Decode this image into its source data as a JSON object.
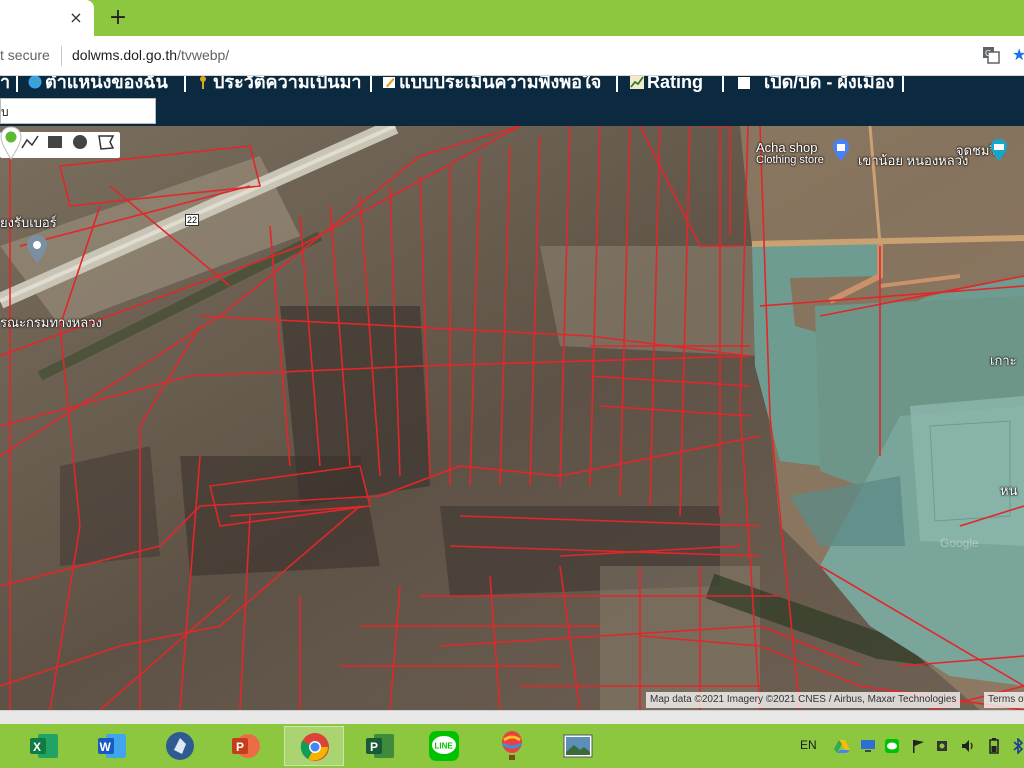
{
  "browser": {
    "tab_close": "×",
    "new_tab": "+",
    "secure_label": "t secure",
    "url_host": "dolwms.dol.go.th",
    "url_path": "/tvwebp/"
  },
  "nav": {
    "items": [
      {
        "label": "า",
        "icon": "home-icon"
      },
      {
        "label": "ตำแหน่งของฉัน",
        "icon": "globe-icon"
      },
      {
        "label": "ประวัติความเป็นมา",
        "icon": "key-icon"
      },
      {
        "label": "แบบประเมินความพึงพอใจ",
        "icon": "pencil-icon"
      },
      {
        "label": "Rating",
        "icon": "chart-icon"
      },
      {
        "label": "เปิด/ปิด - ผังเมือง",
        "icon": "checkbox-icon"
      }
    ],
    "search_value": "บ"
  },
  "map": {
    "labels": {
      "acha_shop": "Acha shop",
      "clothing_store": "Clothing store",
      "viewpoint": "จุดชมวิว",
      "khao_noi": "เขาน้อย หนองหลวง",
      "left_top": "ยงรับเบอร์",
      "road_number": "22",
      "dept_highways": "รณะกรมทางหลวง",
      "island": "เกาะ",
      "east_edge": "หน",
      "watermark": "Google"
    },
    "attribution": "Map data ©2021 Imagery ©2021 CNES / Airbus, Maxar Technologies",
    "terms": "Terms of"
  },
  "taskbar": {
    "apps": [
      {
        "name": "excel-icon",
        "color": "#1d6f42",
        "letter": "X"
      },
      {
        "name": "word-icon",
        "color": "#2b579a",
        "letter": "W"
      },
      {
        "name": "app-icon",
        "color": "#3a6aa8",
        "letter": ""
      },
      {
        "name": "powerpoint-icon",
        "color": "#d24726",
        "letter": "P"
      },
      {
        "name": "chrome-icon",
        "color": "#4285f4",
        "letter": ""
      },
      {
        "name": "project-icon",
        "color": "#31752f",
        "letter": "P"
      },
      {
        "name": "line-icon",
        "color": "#00c300",
        "letter": "LINE"
      },
      {
        "name": "balloon-icon",
        "color": "#e74c3c",
        "letter": ""
      },
      {
        "name": "photos-icon",
        "color": "#5b8fb9",
        "letter": ""
      }
    ],
    "language": "EN"
  }
}
